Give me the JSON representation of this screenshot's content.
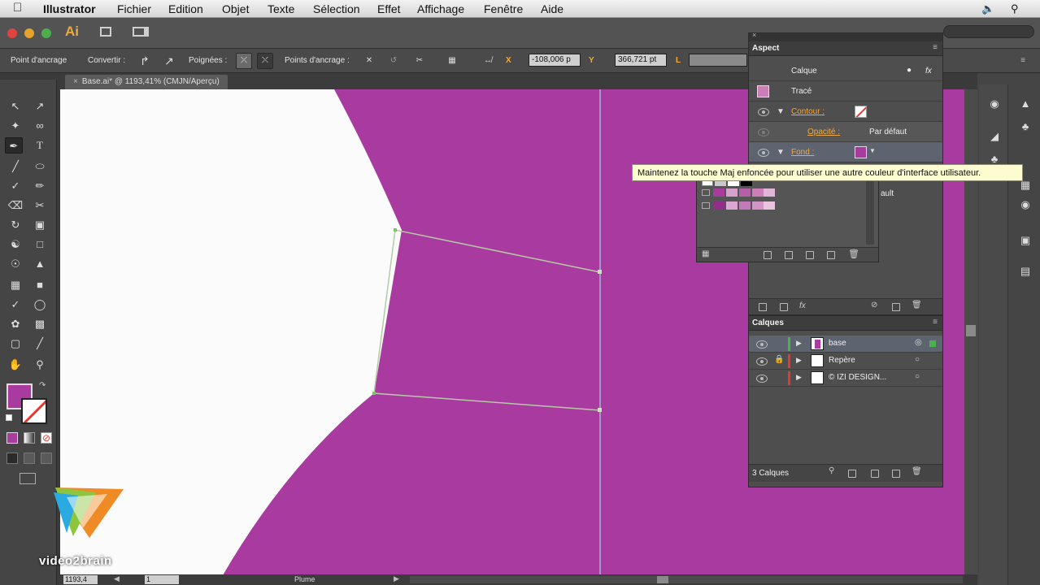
{
  "menubar": {
    "apple": "",
    "items": [
      "Illustrator",
      "Fichier",
      "Edition",
      "Objet",
      "Texte",
      "Sélection",
      "Effet",
      "Affichage",
      "Fenêtre",
      "Aide"
    ]
  },
  "app": {
    "logo": "Ai"
  },
  "control_bar": {
    "anchor_label": "Point d'ancrage",
    "convert_label": "Convertir :",
    "handles_label": "Poignées :",
    "anchors_label": "Points d'ancrage :",
    "x_label": "X",
    "x_value": "-108,006 p",
    "y_label": "Y",
    "y_value": "366,721 pt",
    "l_label": "L"
  },
  "document": {
    "tab": "Base.ai* @ 1193,41% (CMJN/Aperçu)"
  },
  "status_bar": {
    "zoom": "1193,4",
    "page": "1",
    "tool": "Plume"
  },
  "aspect_panel": {
    "title": "Aspect",
    "header": "Calque",
    "fx": "fx",
    "trace_label": "Tracé",
    "rows": [
      {
        "label": "Contour :"
      },
      {
        "label": "Opacité :",
        "value": "Par défaut"
      },
      {
        "label": "Fond :"
      }
    ],
    "partial_text": "ault"
  },
  "calques_panel": {
    "title": "Calques",
    "layers": [
      {
        "name": "base",
        "color": "#4caf50"
      },
      {
        "name": "Repère",
        "color": "#e53935"
      },
      {
        "name": "© IZI DESIGN...",
        "color": "#e53935"
      }
    ],
    "count": "3 Calques"
  },
  "tooltip": {
    "text": "Maintenez la touche Maj enfoncée pour utiliser une autre couleur d'interface utilisateur."
  },
  "watermark": {
    "text": "video2brain"
  },
  "colors": {
    "shape_fill": "#a93a9f",
    "guide": "#9db6d8",
    "selection_path": "#b5c9a6",
    "panel_bg": "#4e4e4e",
    "accent_orange": "#f2a93b"
  },
  "icons": [
    "apple-icon",
    "volume-icon",
    "search-icon",
    "selection-tool-icon",
    "direct-selection-icon",
    "pen-tool-icon",
    "type-tool-icon",
    "eye-icon",
    "lock-icon"
  ]
}
